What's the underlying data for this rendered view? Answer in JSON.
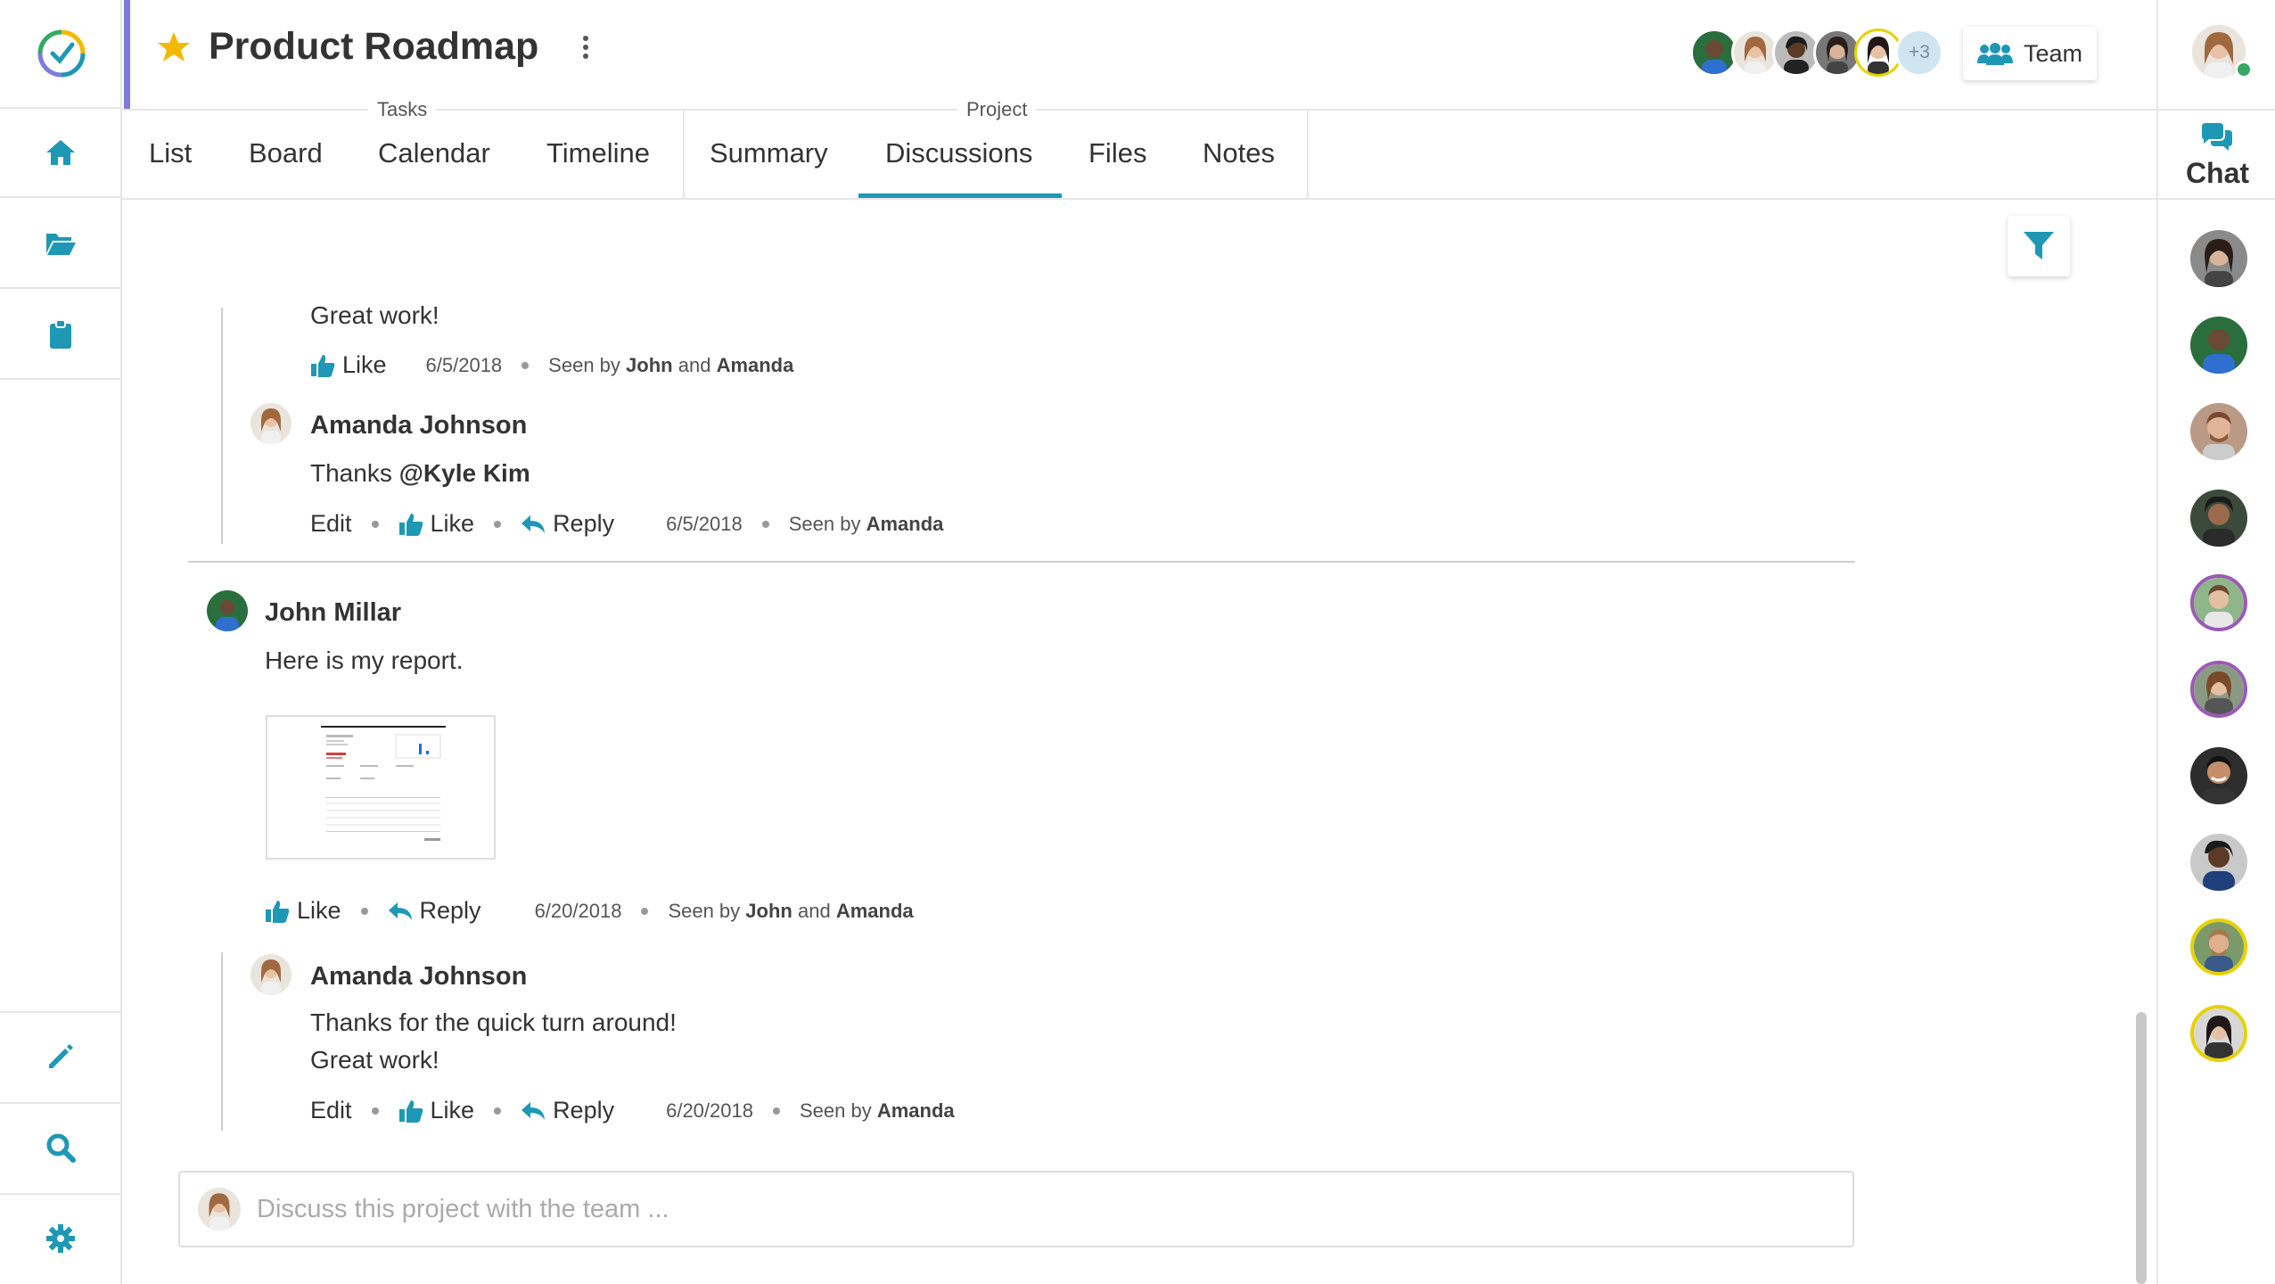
{
  "header": {
    "title": "Product Roadmap",
    "team_label": "Team",
    "more_count": "+3"
  },
  "tab_groups": {
    "tasks": "Tasks",
    "project": "Project"
  },
  "tabs": [
    {
      "label": "List"
    },
    {
      "label": "Board"
    },
    {
      "label": "Calendar"
    },
    {
      "label": "Timeline"
    },
    {
      "label": "Summary"
    },
    {
      "label": "Discussions",
      "active": true
    },
    {
      "label": "Files"
    },
    {
      "label": "Notes"
    }
  ],
  "chat": {
    "label": "Chat"
  },
  "thread": {
    "top_text": "Great work!",
    "top_meta": {
      "like": "Like",
      "date": "6/5/2018",
      "seen_prefix": "Seen by",
      "seen_a": "John",
      "seen_and": "and",
      "seen_b": "Amanda"
    },
    "reply1": {
      "author": "Amanda Johnson",
      "text_prefix": "Thanks",
      "mention": "@Kyle Kim",
      "edit": "Edit",
      "like": "Like",
      "reply": "Reply",
      "date": "6/5/2018",
      "seen_prefix": "Seen by",
      "seen_a": "Amanda"
    },
    "post2": {
      "author": "John Millar",
      "text": "Here is my report.",
      "like": "Like",
      "reply": "Reply",
      "date": "6/20/2018",
      "seen_prefix": "Seen by",
      "seen_a": "John",
      "seen_and": "and",
      "seen_b": "Amanda"
    },
    "reply2": {
      "author": "Amanda Johnson",
      "line1": "Thanks for the quick turn around!",
      "line2": "Great work!",
      "edit": "Edit",
      "like": "Like",
      "reply": "Reply",
      "date": "6/20/2018",
      "seen_prefix": "Seen by",
      "seen_a": "Amanda"
    }
  },
  "compose": {
    "placeholder": "Discuss this project with the team ..."
  },
  "colors": {
    "accent": "#1e98b4",
    "header_bar": "#7d7bdd",
    "star": "#f5b800"
  }
}
